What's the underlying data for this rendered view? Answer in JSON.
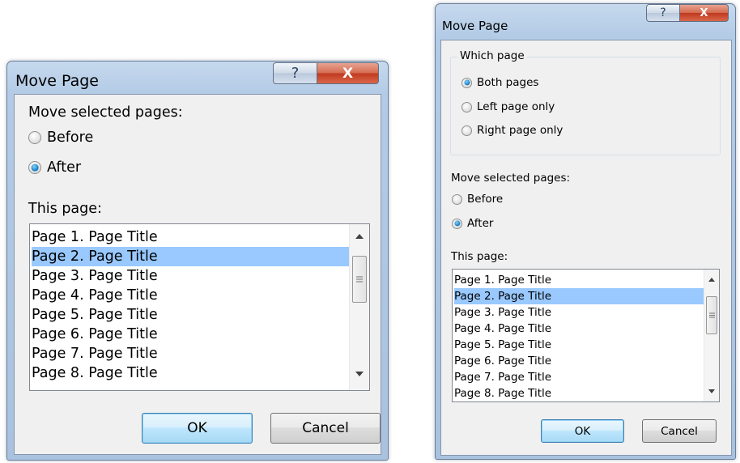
{
  "dialog_small": {
    "title": "Move Page",
    "help_glyph": "?",
    "close_glyph": "X",
    "move_label": "Move selected pages:",
    "radios": [
      {
        "label": "Before",
        "checked": false
      },
      {
        "label": "After",
        "checked": true
      }
    ],
    "list_label": "This page:",
    "list_items": [
      "Page 1. Page Title",
      "Page 2. Page Title",
      "Page 3. Page Title",
      "Page 4. Page Title",
      "Page 5. Page Title",
      "Page 6. Page Title",
      "Page 7. Page Title",
      "Page 8. Page Title"
    ],
    "selected_index": 1,
    "ok_label": "OK",
    "cancel_label": "Cancel"
  },
  "dialog_large": {
    "title": "Move Page",
    "help_glyph": "?",
    "close_glyph": "X",
    "which_caption": "Which page",
    "which_radios": [
      {
        "label": "Both pages",
        "checked": true
      },
      {
        "label": "Left page only",
        "checked": false
      },
      {
        "label": "Right page only",
        "checked": false
      }
    ],
    "move_label": "Move selected pages:",
    "radios": [
      {
        "label": "Before",
        "checked": false
      },
      {
        "label": "After",
        "checked": true
      }
    ],
    "list_label": "This page:",
    "list_items": [
      "Page 1. Page Title",
      "Page 2. Page Title",
      "Page 3. Page Title",
      "Page 4. Page Title",
      "Page 5. Page Title",
      "Page 6. Page Title",
      "Page 7. Page Title",
      "Page 8. Page Title"
    ],
    "selected_index": 1,
    "ok_label": "OK",
    "cancel_label": "Cancel"
  },
  "icons": {
    "scroll_up": "scroll-up-icon",
    "scroll_down": "scroll-down-icon",
    "scroll_grip": "scroll-grip-icon"
  }
}
